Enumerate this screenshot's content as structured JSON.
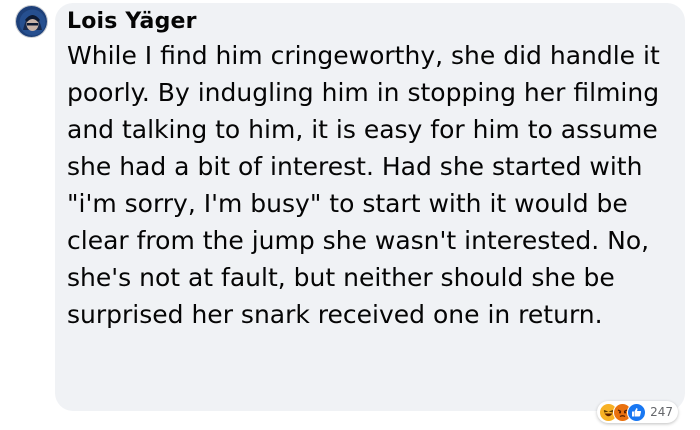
{
  "comment": {
    "author": "Lois Yäger",
    "text": "While I find him cringeworthy, she did handle it poorly. By indugling him in stopping her filming and talking to him, it is easy for him to assume she had a bit of interest. Had she started with \"i'm sorry, I'm busy\" to start with it would be clear from the jump she wasn't interested. No, she's not at fault, but neither should she be surprised her snark received one in return.",
    "reactions": {
      "icons": [
        "haha-icon",
        "angry-icon",
        "like-icon"
      ],
      "count": "247"
    }
  },
  "colors": {
    "bubble": "#f0f2f5",
    "text": "#050505",
    "meta": "#65676b",
    "like": "#1877f2",
    "haha": "#f7b125",
    "angry": "#e9710f"
  }
}
